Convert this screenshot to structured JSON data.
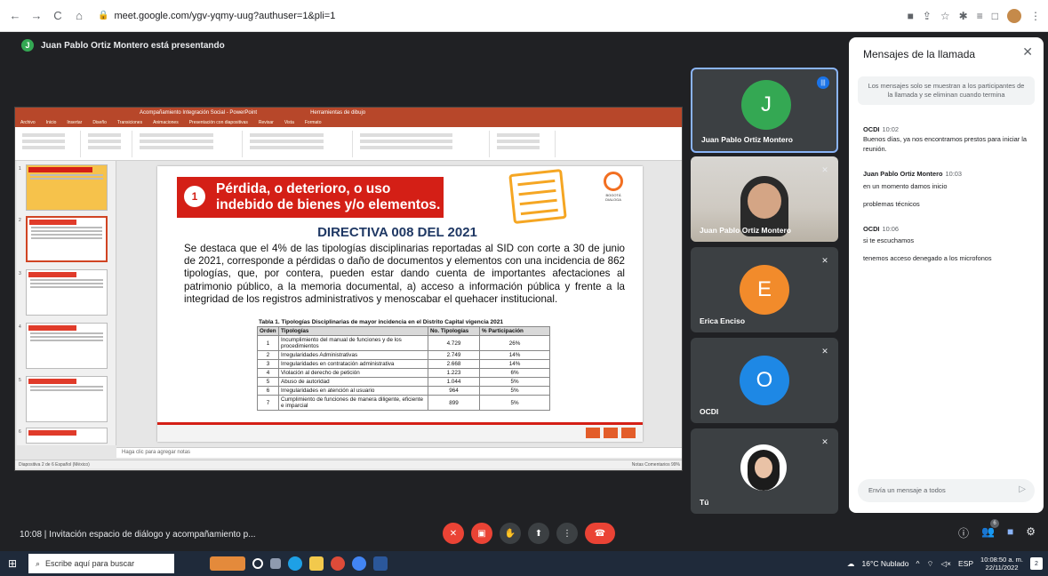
{
  "browser": {
    "url": "meet.google.com/ygv-yqmy-uug?authuser=1&pli=1",
    "back_glyph": "←",
    "forward_glyph": "→",
    "reload_glyph": "C",
    "home_glyph": "⌂",
    "lock_glyph": "🔒",
    "menu_glyph": "⋮"
  },
  "meet": {
    "presenting_banner": "Juan Pablo Ortiz Montero está presentando",
    "presenter_initial": "J"
  },
  "ppt": {
    "window_title": "Acompañamiento Integración Social - PowerPoint",
    "tools_tab": "Herramientas de dibujo",
    "tabs": [
      "Archivo",
      "Inicio",
      "Insertar",
      "Diseño",
      "Transiciones",
      "Animaciones",
      "Presentación con diapositivas",
      "Revisar",
      "Vista",
      "Formato"
    ],
    "notes_placeholder": "Haga clic para agregar notas",
    "status_left": "Diapositiva 2 de 6   Español (México)",
    "status_right": "Notas   Comentarios   99%"
  },
  "slide": {
    "number": "1",
    "header": "Pérdida, o deterioro, o uso indebido de bienes  y/o  elementos.",
    "seal_text": "BOGOTÁ DIALOGA",
    "directiva": "DIRECTIVA 008 DEL 2021",
    "body": "Se destaca que el 4% de las tipologías disciplinarias reportadas al SID con corte a 30 de junio de 2021, corresponde a pérdidas o daño de documentos y elementos con una incidencia de 862 tipologías, que, por contera, pueden estar dando cuenta de importantes afectaciones al patrimonio público, a la memoria documental, a) acceso a información pública y frente a la integridad de los registros administrativos y menoscabar el quehacer institucional.",
    "table_title": "Tabla 1. Tipologías Disciplinarias de mayor incidencia en el Distrito Capital vigencia 2021",
    "table_headers": [
      "Orden",
      "Tipologías",
      "No. Tipologías",
      "% Participación"
    ],
    "table_rows": [
      [
        "1",
        "Incumplimiento del manual de funciones y de los procedimientos",
        "4.729",
        "26%"
      ],
      [
        "2",
        "Irregularidades Administrativas",
        "2.749",
        "14%"
      ],
      [
        "3",
        "Irregularidades en contratación administrativa",
        "2.668",
        "14%"
      ],
      [
        "4",
        "Violación al derecho de petición",
        "1.223",
        "6%"
      ],
      [
        "5",
        "Abuso de autoridad",
        "1.044",
        "5%"
      ],
      [
        "6",
        "Irregularidades en atención al usuario",
        "964",
        "5%"
      ],
      [
        "7",
        "Cumplimiento de funciones de manera diligente, eficiente e imparcial",
        "899",
        "5%"
      ]
    ]
  },
  "participants": [
    {
      "name": "Juan Pablo Ortiz Montero",
      "initial": "J",
      "color": "#34a853"
    },
    {
      "name": "Juan Pablo Ortiz Montero"
    },
    {
      "name": "Erica Enciso",
      "initial": "E",
      "color": "#f28b2b"
    },
    {
      "name": "OCDI",
      "initial": "O",
      "color": "#1e88e5"
    },
    {
      "name": "Tú"
    }
  ],
  "chat": {
    "title": "Mensajes de la llamada",
    "close_glyph": "✕",
    "notice": "Los mensajes solo se muestran a los participantes de la llamada y se eliminan cuando termina",
    "messages": [
      {
        "sender": "OCDI",
        "time": "10:02",
        "lines": [
          "Buenos días, ya nos encontramos prestos para iniciar la reunión."
        ]
      },
      {
        "sender": "Juan Pablo Ortiz Montero",
        "time": "10:03",
        "lines": [
          "en un momento damos inicio",
          "problemas técnicos"
        ]
      },
      {
        "sender": "OCDI",
        "time": "10:06",
        "lines": [
          "si te escuchamos",
          "tenemos acceso denegado a los microfonos"
        ]
      }
    ],
    "input_placeholder": "Envía un mensaje a todos",
    "send_glyph": "▷"
  },
  "bottom": {
    "meeting_info": "10:08  |  Invitación espacio de diálogo y acompañamiento p...",
    "people_count": "6"
  },
  "taskbar": {
    "search_placeholder": "Escribe aquí para buscar",
    "weather": "16°C  Nublado",
    "language": "ESP",
    "time": "10:08:50 a. m.",
    "date": "22/11/2022",
    "notif_count": "2"
  },
  "colors": {
    "meet_bg": "#202124",
    "tile_bg": "#3c4043",
    "end_call": "#ea4335",
    "ppt_brand": "#b7472a",
    "slide_red": "#d41f16"
  }
}
